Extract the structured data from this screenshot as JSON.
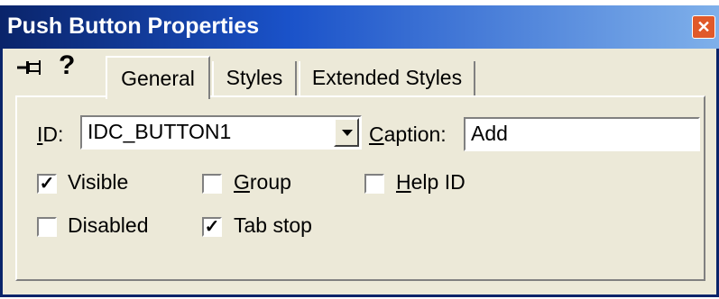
{
  "window": {
    "title": "Push Button Properties",
    "close_glyph": "✕"
  },
  "toolbar": {
    "pin_icon": "pin-icon",
    "help_icon": "help-icon"
  },
  "tabs": [
    {
      "label": "General",
      "active": true
    },
    {
      "label": "Styles",
      "active": false
    },
    {
      "label": "Extended Styles",
      "active": false
    }
  ],
  "general": {
    "id_label": "ID:",
    "id_value": "IDC_BUTTON1",
    "caption_label": "Caption:",
    "caption_value": "Add",
    "checkboxes": [
      {
        "label": "Visible",
        "checked": true
      },
      {
        "label": "Group",
        "checked": false
      },
      {
        "label": "Help ID",
        "checked": false
      },
      {
        "label": "Disabled",
        "checked": false
      },
      {
        "label": "Tab stop",
        "checked": true
      }
    ]
  },
  "colors": {
    "titlebar_start": "#0a246a",
    "titlebar_end": "#7fb0ea",
    "dialog_bg": "#ece9d8"
  }
}
